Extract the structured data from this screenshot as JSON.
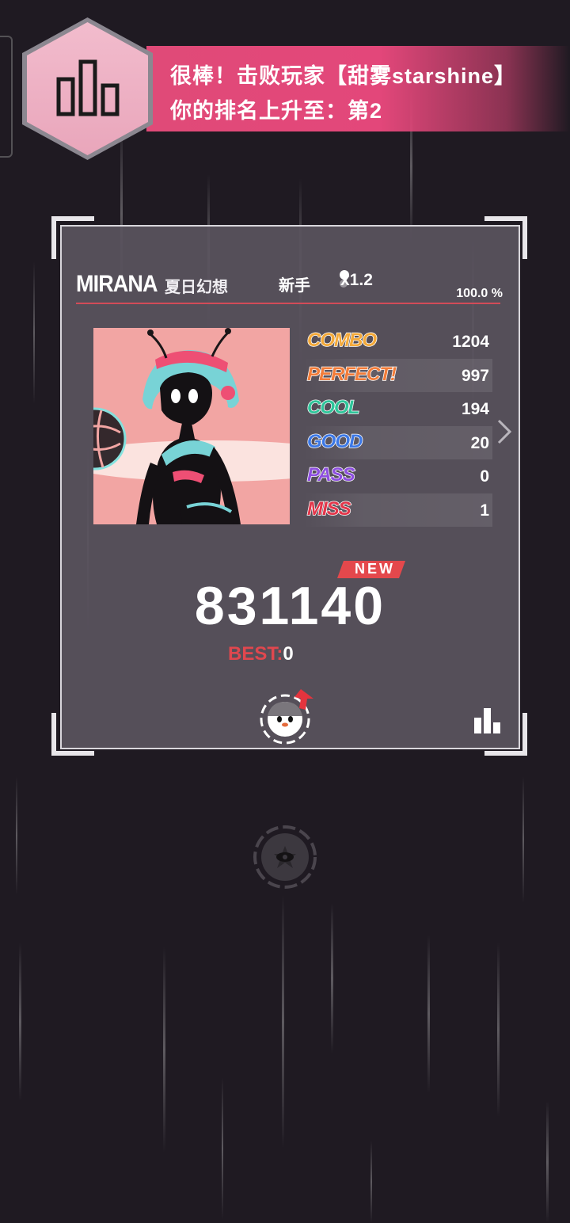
{
  "banner": {
    "line1": "很棒！击败玩家【甜雾starshine】",
    "line2": "你的排名上升至：第2",
    "icon": "ranking-bars-icon"
  },
  "song": {
    "title": "MIRANA",
    "subtitle": "夏日幻想",
    "difficulty": "新手",
    "multiplier": "x1.2",
    "accuracy": "100.0 %"
  },
  "judgements": [
    {
      "label": "COMBO",
      "value": "1204",
      "color": "#f3a93a"
    },
    {
      "label": "PERFECT!",
      "value": "997",
      "color": "#f27d3a"
    },
    {
      "label": "COOL",
      "value": "194",
      "color": "#2fc59a"
    },
    {
      "label": "GOOD",
      "value": "20",
      "color": "#3c78e6"
    },
    {
      "label": "PASS",
      "value": "0",
      "color": "#8e4fe0"
    },
    {
      "label": "MISS",
      "value": "1",
      "color": "#e3364a"
    }
  ],
  "result": {
    "new_badge": "NEW",
    "score": "831140",
    "best_label": "BEST:",
    "best_value": "0"
  },
  "colors": {
    "accent_pink": "#e3477a",
    "rule_red": "#d24b58",
    "best_red": "#e0474e"
  },
  "icons": {
    "next": "chevron-right-icon",
    "avatar": "player-avatar-icon",
    "rank": "rank-up-arrow-icon",
    "leaderboard": "leaderboard-bars-icon",
    "view": "eye-icon"
  }
}
